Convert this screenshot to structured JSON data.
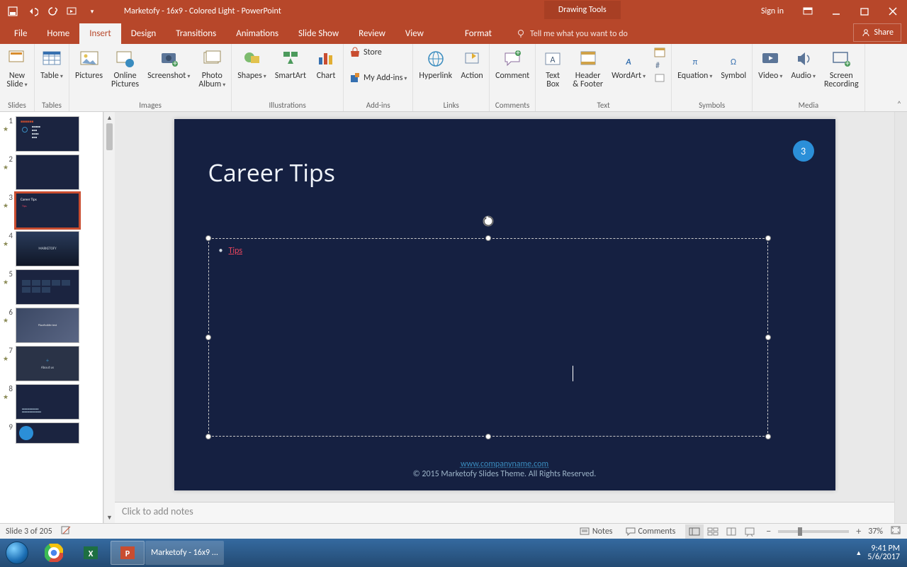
{
  "titlebar": {
    "document_title": "Marketofy - 16x9 - Colored Light - PowerPoint",
    "contextual_tab_group": "Drawing Tools",
    "sign_in": "Sign in"
  },
  "tabs": {
    "file": "File",
    "home": "Home",
    "insert": "Insert",
    "design": "Design",
    "transitions": "Transitions",
    "animations": "Animations",
    "slideshow": "Slide Show",
    "review": "Review",
    "view": "View",
    "format": "Format",
    "tell_me": "Tell me what you want to do",
    "share": "Share"
  },
  "ribbon": {
    "groups": {
      "slides": "Slides",
      "tables": "Tables",
      "images": "Images",
      "illustrations": "Illustrations",
      "addins": "Add-ins",
      "links": "Links",
      "comments": "Comments",
      "text": "Text",
      "symbols": "Symbols",
      "media": "Media"
    },
    "new_slide": "New\nSlide",
    "table": "Table",
    "pictures": "Pictures",
    "online_pictures": "Online\nPictures",
    "screenshot": "Screenshot",
    "photo_album": "Photo\nAlbum",
    "shapes": "Shapes",
    "smartart": "SmartArt",
    "chart": "Chart",
    "store": "Store",
    "my_addins": "My Add-ins",
    "hyperlink": "Hyperlink",
    "action": "Action",
    "comment": "Comment",
    "text_box": "Text\nBox",
    "header_footer": "Header\n& Footer",
    "wordart": "WordArt",
    "equation": "Equation",
    "symbol": "Symbol",
    "video": "Video",
    "audio": "Audio",
    "screen_recording": "Screen\nRecording"
  },
  "thumbnails": {
    "items": [
      {
        "n": "1"
      },
      {
        "n": "2"
      },
      {
        "n": "3"
      },
      {
        "n": "4"
      },
      {
        "n": "5"
      },
      {
        "n": "6"
      },
      {
        "n": "7"
      },
      {
        "n": "8"
      },
      {
        "n": "9"
      }
    ]
  },
  "slide": {
    "title": "Career Tips",
    "bullet1": "Tips",
    "badge": "3",
    "footer_link": "www.companyname.com",
    "footer_copyright": "© 2015 Marketofy Slides Theme. All Rights Reserved."
  },
  "notes": {
    "placeholder": "Click to add notes"
  },
  "statusbar": {
    "slide_index": "Slide 3 of 205",
    "notes": "Notes",
    "comments": "Comments",
    "zoom": "37%"
  },
  "taskbar": {
    "active_doc": "Marketofy - 16x9 ...",
    "time": "9:41 PM",
    "date": "5/6/2017"
  }
}
